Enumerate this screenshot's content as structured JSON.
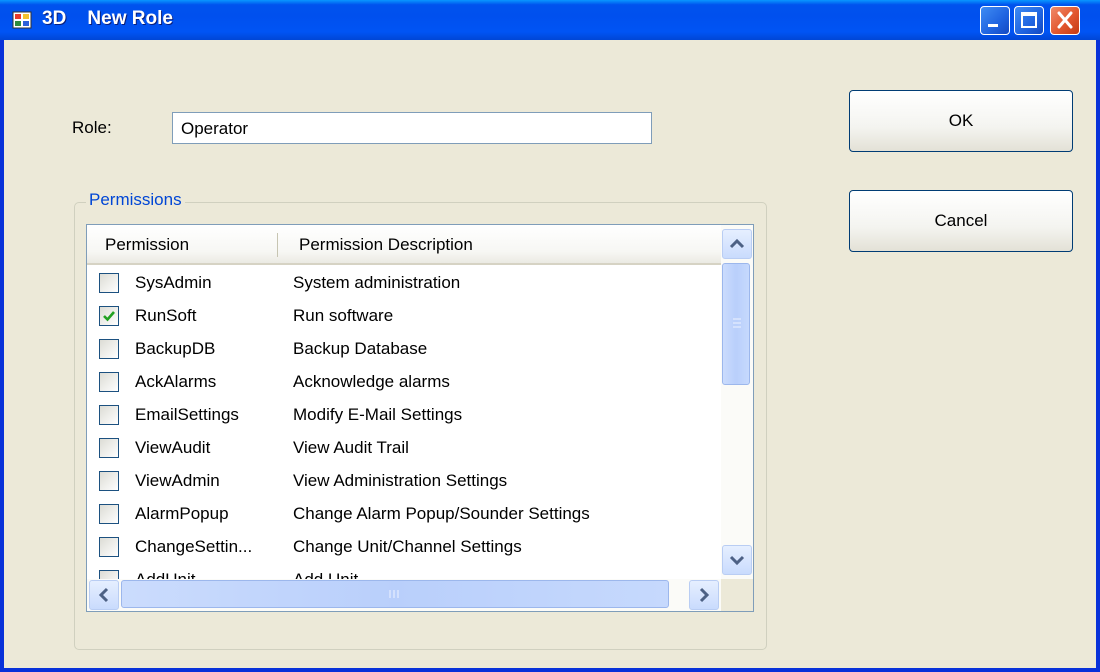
{
  "window": {
    "title": "3D    New Role",
    "accent_color": "#0054e3",
    "controls": [
      "minimize-icon",
      "maximize-icon",
      "close-icon"
    ]
  },
  "form": {
    "role_label": "Role:",
    "role_value": "Operator"
  },
  "buttons": {
    "ok_label": "OK",
    "cancel_label": "Cancel"
  },
  "permissions": {
    "group_title": "Permissions",
    "columns": [
      "Permission",
      "Permission Description"
    ],
    "rows": [
      {
        "name": "SysAdmin",
        "description": "System administration",
        "checked": false
      },
      {
        "name": "RunSoft",
        "description": "Run software",
        "checked": true
      },
      {
        "name": "BackupDB",
        "description": "Backup Database",
        "checked": false
      },
      {
        "name": "AckAlarms",
        "description": "Acknowledge alarms",
        "checked": false
      },
      {
        "name": "EmailSettings",
        "description": "Modify E-Mail Settings",
        "checked": false
      },
      {
        "name": "ViewAudit",
        "description": "View Audit Trail",
        "checked": false
      },
      {
        "name": "ViewAdmin",
        "description": "View Administration Settings",
        "checked": false
      },
      {
        "name": "AlarmPopup",
        "description": "Change Alarm Popup/Sounder Settings",
        "checked": false
      },
      {
        "name": "ChangeSettin...",
        "description": "Change Unit/Channel Settings",
        "checked": false
      },
      {
        "name": "AddUnit",
        "description": "Add Unit",
        "checked": false
      }
    ]
  }
}
